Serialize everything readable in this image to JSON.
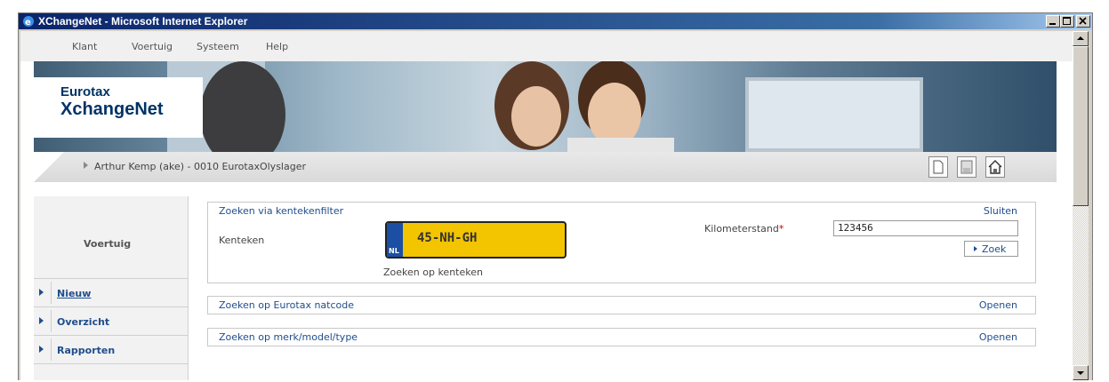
{
  "window": {
    "title": "XChangeNet - Microsoft Internet Explorer"
  },
  "menu": [
    "Klant",
    "Voertuig",
    "Systeem",
    "Help"
  ],
  "banner": {
    "logo_line1": "Eurotax",
    "logo_line2": "XchangeNet"
  },
  "breadcrumb": {
    "text": "Arthur Kemp (ake) - 0010 EurotaxOlyslager"
  },
  "sidebar": {
    "heading": "Voertuig",
    "items": [
      {
        "label": "Nieuw"
      },
      {
        "label": "Overzicht"
      },
      {
        "label": "Rapporten"
      }
    ]
  },
  "search_plate": {
    "title": "Zoeken via kentekenfilter",
    "close_label": "Sluiten",
    "plate_label": "Kenteken",
    "plate_value": "45-NH-GH",
    "plate_country": "NL",
    "plate_caption": "Zoeken op kenteken",
    "km_label": "Kilometerstand",
    "km_required": "*",
    "km_value": "123456",
    "search_button": "Zoek"
  },
  "panels": [
    {
      "title": "Zoeken op Eurotax natcode",
      "action": "Openen"
    },
    {
      "title": "Zoeken op merk/model/type",
      "action": "Openen"
    }
  ],
  "colors": {
    "accent": "#1f4e8c",
    "required": "#cc0000",
    "plate": "#f3c400"
  }
}
